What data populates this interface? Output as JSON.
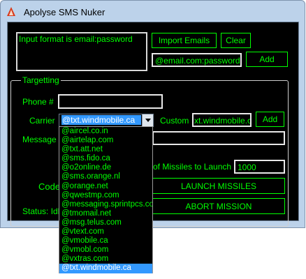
{
  "window": {
    "title": "Apolyse SMS Nuker"
  },
  "accounts": {
    "format_hint": "Input format is email:password",
    "import_label": "Import Emails",
    "clear_label": "Clear",
    "entry_value": "@email.com:password",
    "add_label": "Add"
  },
  "targetting": {
    "group_label": "Targetting",
    "phone_label": "Phone #",
    "phone_value": "",
    "carrier_label": "Carrier",
    "carrier_selected": "@txt.windmobile.ca",
    "custom_label": "Custom",
    "custom_value": "xt.windmobile.ca",
    "custom_add_label": "Add",
    "message_label": "Message",
    "message_value": "",
    "missiles_label": "# of Missiles to Launch",
    "missiles_value": "1000",
    "code_label": "Code",
    "status_label": "Status: Idle",
    "launch_label": "LAUNCH MISSILES",
    "abort_label": "ABORT MISSION"
  },
  "carrier_options": [
    "@aircel.co.in",
    "@airtelap.com",
    "@txt.att.net",
    "@sms.fido.ca",
    "@o2online.de",
    "@sms.orange.nl",
    "@orange.net",
    "@qwestmp.com",
    "@messaging.sprintpcs.com",
    "@tmomail.net",
    "@msg.telus.com",
    "@vtext.com",
    "@vmobile.ca",
    "@vmobl.com",
    "@vxtras.com",
    "@txt.windmobile.ca"
  ],
  "selected_carrier_index": 15,
  "colors": {
    "accent": "#00ff00",
    "background": "#000000",
    "selection": "#3399ff",
    "window_frame": "#bcd2ea"
  }
}
